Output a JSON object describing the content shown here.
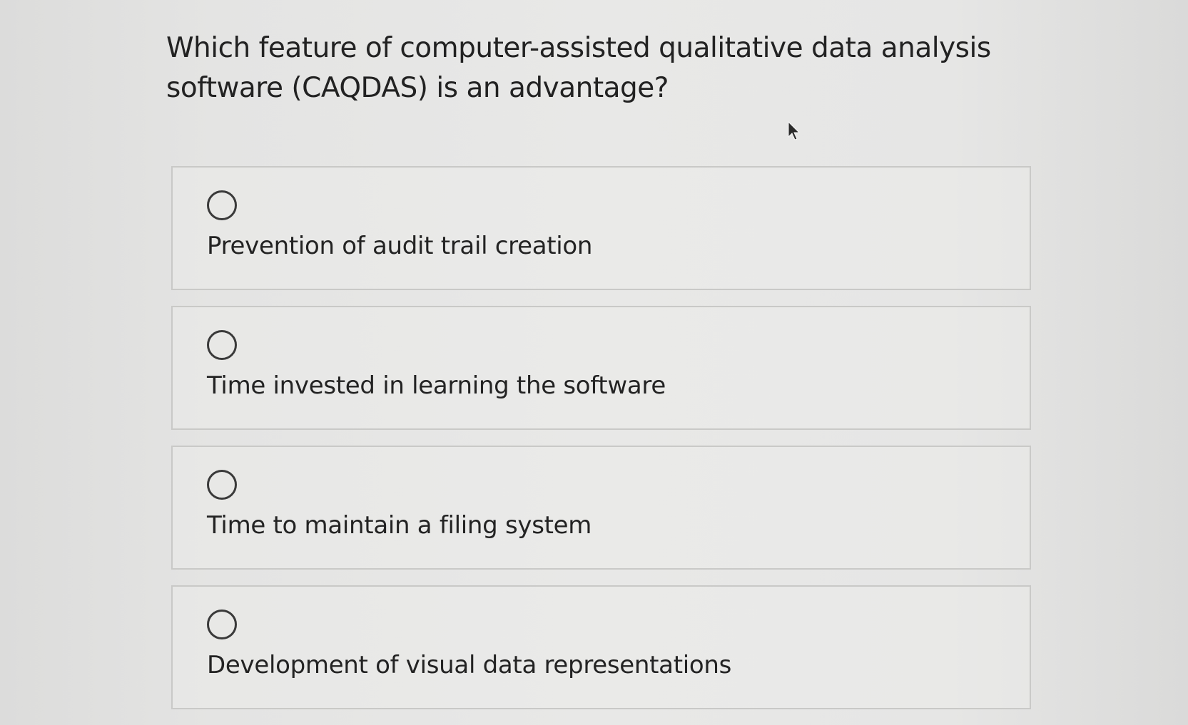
{
  "question": {
    "text": "Which feature of computer-assisted qualitative data analysis software (CAQDAS) is an advantage?"
  },
  "options": [
    {
      "label": "Prevention of audit trail creation",
      "selected": false
    },
    {
      "label": "Time invested in learning the software",
      "selected": false
    },
    {
      "label": "Time to maintain a filing system",
      "selected": false
    },
    {
      "label": "Development of visual data representations",
      "selected": false
    }
  ],
  "cursor": {
    "icon": "mouse-pointer-icon"
  }
}
